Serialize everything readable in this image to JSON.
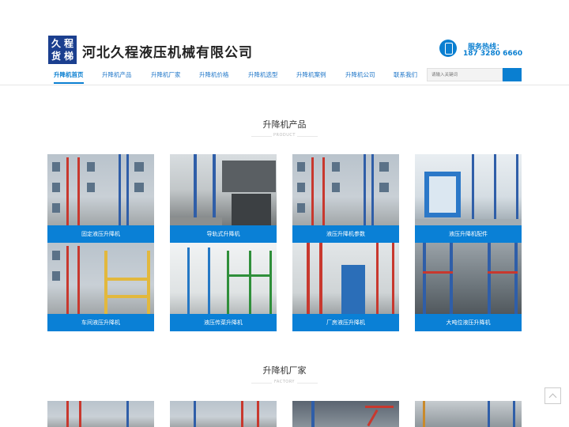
{
  "header": {
    "logo_chars": [
      "久",
      "程",
      "货",
      "梯"
    ],
    "company_name": "河北久程液压机械有限公司",
    "hotline_label": "服务热线：",
    "hotline_number": "187 3280 6660",
    "phone_icon": "phone-icon"
  },
  "nav": {
    "items": [
      {
        "label": "升降机首页",
        "active": true
      },
      {
        "label": "升降机产品",
        "active": false
      },
      {
        "label": "升降机厂家",
        "active": false
      },
      {
        "label": "升降机价格",
        "active": false
      },
      {
        "label": "升降机选型",
        "active": false
      },
      {
        "label": "升降机案例",
        "active": false
      },
      {
        "label": "升降机公司",
        "active": false
      },
      {
        "label": "联系我们",
        "active": false
      }
    ],
    "search_placeholder": "请输入关键词"
  },
  "products_section": {
    "title": "升降机产品",
    "subtitle": "PRODUCT",
    "cards": [
      {
        "caption": "固定液压升降机"
      },
      {
        "caption": "导轨式升降机"
      },
      {
        "caption": "液压升降机参数"
      },
      {
        "caption": "液压升降机配件"
      },
      {
        "caption": "车间液压升降机"
      },
      {
        "caption": "液压传菜升降机"
      },
      {
        "caption": "厂房液压升降机"
      },
      {
        "caption": "大吨位液压升降机"
      }
    ]
  },
  "factory_section": {
    "title": "升降机厂家",
    "subtitle": "FACTORY"
  },
  "colors": {
    "accent": "#0a80d6",
    "nav_text": "#1a73c7",
    "logo_bg": "#1b3f8f"
  }
}
